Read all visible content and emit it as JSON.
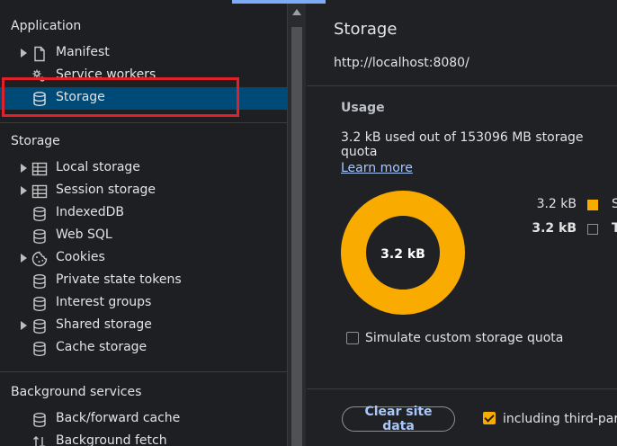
{
  "sidebar": {
    "application_header": "Application",
    "application_items": [
      {
        "label": "Manifest",
        "icon": "document-icon",
        "expandable": true
      },
      {
        "label": "Service workers",
        "icon": "gear-icon",
        "expandable": false
      },
      {
        "label": "Storage",
        "icon": "database-icon",
        "expandable": false,
        "selected": true
      }
    ],
    "storage_header": "Storage",
    "storage_items": [
      {
        "label": "Local storage",
        "icon": "table-icon",
        "expandable": true
      },
      {
        "label": "Session storage",
        "icon": "table-icon",
        "expandable": true
      },
      {
        "label": "IndexedDB",
        "icon": "database-icon",
        "expandable": false
      },
      {
        "label": "Web SQL",
        "icon": "database-icon",
        "expandable": false
      },
      {
        "label": "Cookies",
        "icon": "cookie-icon",
        "expandable": true
      },
      {
        "label": "Private state tokens",
        "icon": "database-icon",
        "expandable": false
      },
      {
        "label": "Interest groups",
        "icon": "database-icon",
        "expandable": false
      },
      {
        "label": "Shared storage",
        "icon": "database-icon",
        "expandable": true
      },
      {
        "label": "Cache storage",
        "icon": "database-icon",
        "expandable": false
      }
    ],
    "background_header": "Background services",
    "background_items": [
      {
        "label": "Back/forward cache",
        "icon": "database-icon"
      },
      {
        "label": "Background fetch",
        "icon": "arrows-icon"
      }
    ]
  },
  "main": {
    "title": "Storage",
    "url": "http://localhost:8080/",
    "usage_heading": "Usage",
    "usage_text": "3.2 kB used out of 153096 MB storage quota",
    "learn_more": "Learn more",
    "donut_label": "3.2 kB",
    "donut_fraction": 1.0,
    "legend": [
      {
        "value": "3.2 kB",
        "name": "S",
        "color": "#f9ab00",
        "bold": false
      },
      {
        "value": "3.2 kB",
        "name": "T",
        "color": "",
        "bold": true
      }
    ],
    "simulate_label": "Simulate custom storage quota",
    "simulate_checked": false,
    "clear_button": "Clear site data",
    "including_label": "including third-part",
    "including_checked": true
  },
  "colors": {
    "accent": "#f9ab00",
    "selected": "#004a77",
    "link": "#a8c7fa",
    "highlight": "#e0212a"
  }
}
